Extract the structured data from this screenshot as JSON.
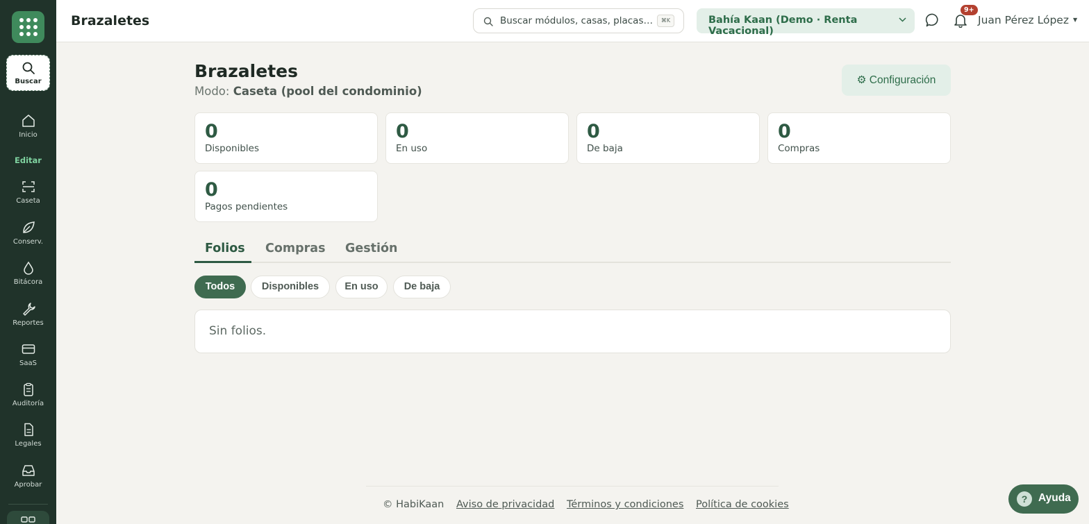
{
  "sidebar": {
    "search_label": "Buscar",
    "edit_label": "Editar",
    "items": [
      {
        "label": "Inicio",
        "icon": "home-icon"
      },
      {
        "label": "Caseta",
        "icon": "scan-icon"
      },
      {
        "label": "Conserv.",
        "icon": "leaf-icon"
      },
      {
        "label": "Bitácora",
        "icon": "drop-icon"
      },
      {
        "label": "Reportes",
        "icon": "wrench-icon"
      },
      {
        "label": "SaaS",
        "icon": "card-icon"
      },
      {
        "label": "Auditoría",
        "icon": "clipboard-icon"
      },
      {
        "label": "Legales",
        "icon": "document-icon"
      },
      {
        "label": "Aprobar",
        "icon": "inbox-icon"
      }
    ]
  },
  "topbar": {
    "title": "Brazaletes",
    "search_placeholder": "Buscar módulos, casas, placas…",
    "search_shortcut": "⌘K",
    "property": "Bahía Kaan (Demo · Renta Vacacional)",
    "notifications_badge": "9+",
    "user_name": "Juan Pérez López"
  },
  "page": {
    "title": "Brazaletes",
    "mode_label": "Modo:",
    "mode_value": "Caseta (pool del condominio)",
    "config_button": "⚙ Configuración"
  },
  "stats": [
    {
      "value": "0",
      "label": "Disponibles"
    },
    {
      "value": "0",
      "label": "En uso"
    },
    {
      "value": "0",
      "label": "De baja"
    },
    {
      "value": "0",
      "label": "Compras"
    },
    {
      "value": "0",
      "label": "Pagos pendientes"
    }
  ],
  "tabs": [
    {
      "label": "Folios",
      "active": true
    },
    {
      "label": "Compras",
      "active": false
    },
    {
      "label": "Gestión",
      "active": false
    }
  ],
  "filters": [
    {
      "label": "Todos",
      "active": true
    },
    {
      "label": "Disponibles",
      "active": false
    },
    {
      "label": "En uso",
      "active": false
    },
    {
      "label": "De baja",
      "active": false
    }
  ],
  "empty_message": "Sin folios.",
  "footer": {
    "copyright": "© HabiKaan",
    "links": [
      "Aviso de privacidad",
      "Términos y condiciones",
      "Política de cookies"
    ]
  },
  "help_button": "Ayuda",
  "colors": {
    "sidebar_bg": "#20332a",
    "accent": "#2e5a43",
    "accent_soft": "#e3efe8",
    "badge": "#b3402f",
    "page_bg": "#f4f3ef"
  }
}
